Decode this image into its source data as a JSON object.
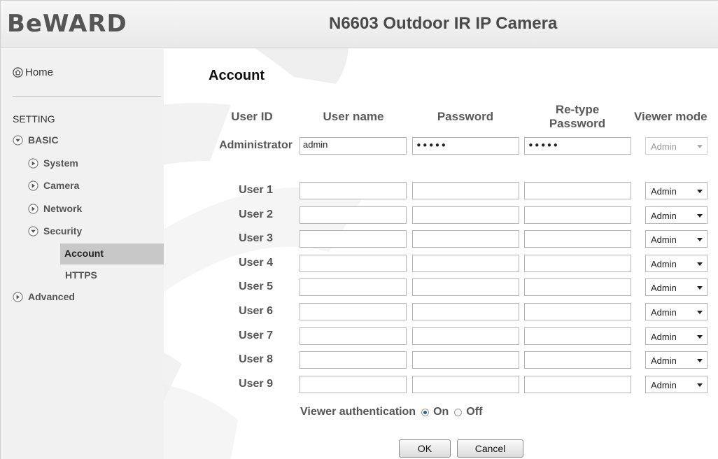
{
  "header": {
    "logo": "BeWARD",
    "title": "N6603 Outdoor IR IP Camera"
  },
  "sidebar": {
    "home": "Home",
    "setting": "SETTING",
    "basic": "BASIC",
    "system": "System",
    "camera": "Camera",
    "network": "Network",
    "security": "Security",
    "account": "Account",
    "https": "HTTPS",
    "advanced": "Advanced"
  },
  "page": {
    "title": "Account"
  },
  "columns": {
    "user_id": "User ID",
    "user_name": "User name",
    "password": "Password",
    "retype_line1": "Re-type",
    "retype_line2": "Password",
    "viewer_mode": "Viewer mode"
  },
  "admin": {
    "label": "Administrator",
    "username": "admin",
    "password": "•••••",
    "retype": "•••••",
    "mode": "Admin"
  },
  "users": [
    {
      "label": "User 1",
      "mode": "Admin"
    },
    {
      "label": "User 2",
      "mode": "Admin"
    },
    {
      "label": "User 3",
      "mode": "Admin"
    },
    {
      "label": "User 4",
      "mode": "Admin"
    },
    {
      "label": "User 5",
      "mode": "Admin"
    },
    {
      "label": "User 6",
      "mode": "Admin"
    },
    {
      "label": "User 7",
      "mode": "Admin"
    },
    {
      "label": "User 8",
      "mode": "Admin"
    },
    {
      "label": "User 9",
      "mode": "Admin"
    }
  ],
  "auth": {
    "label": "Viewer authentication",
    "on": "On",
    "off": "Off",
    "selected": "On"
  },
  "buttons": {
    "ok": "OK",
    "cancel": "Cancel"
  },
  "colors": {
    "sidebar_bg": "#f1f1f1",
    "active_item": "#c8c8c8",
    "header_text": "#4a4a4a"
  },
  "icons": {
    "home": "home-icon",
    "expanded": "chevron-down-circle-icon",
    "collapsed": "chevron-right-circle-icon"
  }
}
